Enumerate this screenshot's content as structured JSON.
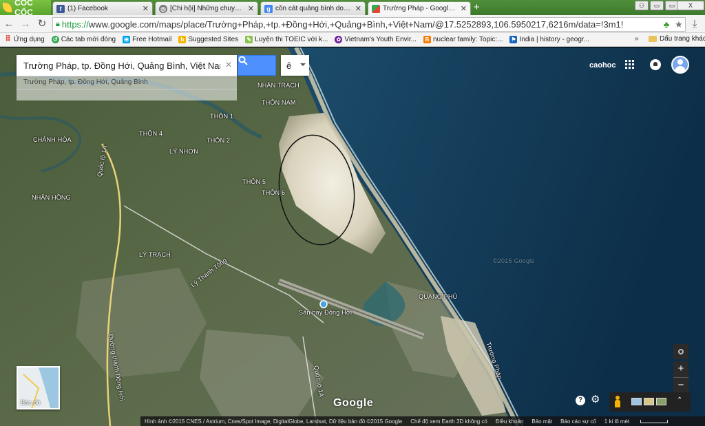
{
  "browser": {
    "brand": "CỐC CỐC",
    "tabs": [
      {
        "title": "(1) Facebook",
        "icon": "facebook-icon"
      },
      {
        "title": "[Chi hội] Những chuyến đi nă",
        "icon": "forum-icon"
      },
      {
        "title": "cồn cát quảng bình dong_hoi",
        "icon": "google-icon"
      },
      {
        "title": "Trường Pháp - Google Maps",
        "icon": "maps-icon",
        "active": true
      }
    ],
    "new_tab": "+",
    "window_controls": [
      "▭",
      "▭",
      "X"
    ],
    "url_scheme": "https://",
    "url_rest": "www.google.com/maps/place/Trường+Pháp,+tp.+Đồng+Hới,+Quảng+Bình,+Việt+Nam/@17.5252893,106.5950217,6216m/data=!3m1!"
  },
  "bookmarks": [
    {
      "label": "Ứng dụng",
      "icon": "apps-grid-icon",
      "color": "#d93025"
    },
    {
      "label": "Các tab mới đóng",
      "icon": "history-icon",
      "color": "#34a853"
    },
    {
      "label": "Free Hotmail",
      "icon": "windows-icon",
      "color": "#00a4ef"
    },
    {
      "label": "Suggested Sites",
      "icon": "bing-icon",
      "color": "#f7b500"
    },
    {
      "label": "Luyện thi TOEIC với k...",
      "icon": "bookmark-icon",
      "color": "#8bc34a"
    },
    {
      "label": "Vietnam's Youth Envir...",
      "icon": "bookmark-icon",
      "color": "#6a1b9a"
    },
    {
      "label": "nuclear family: Topic:...",
      "icon": "blogger-icon",
      "color": "#f57c00"
    },
    {
      "label": "India | history - geogr...",
      "icon": "bookmark-icon",
      "color": "#1565c0"
    }
  ],
  "bookmarks_more": "»",
  "bookmarks_other": "Dấu trang khác",
  "maps": {
    "search_value": "Trường Pháp, tp. Đồng Hới, Quảng Bình, Việt Nam",
    "suggestion": "Trường Pháp, tp. Đồng Hới, Quảng Bình",
    "ime_label": "ê",
    "user_name": "caohoc",
    "minimap_label": "Bản đồ",
    "google_logo": "Google",
    "zoom_in": "+",
    "zoom_out": "−",
    "help": "?",
    "expand": "⌃",
    "attribution": [
      "Hình ảnh ©2015 CNES / Astrium, Cnes/Spot Image, DigitalGlobe, Landsat, Dữ liệu bản đồ ©2015 Google",
      "Chế độ xem Earth 3D không có",
      "Điều khoản",
      "Bảo mật",
      "Báo cáo sự cố",
      "1 ki lô mét"
    ],
    "place_labels": [
      "NHÂN TRẠCH",
      "THÔN NAM",
      "THÔN 1",
      "THÔN 4",
      "THÔN 2",
      "CHÁNH HÒA",
      "LÝ NHƠN",
      "THÔN 5",
      "THÔN 6",
      "NHÂN HỒNG",
      "LÝ TRẠCH",
      "Lý Thánh Tông",
      "Sân bay Đồng Hới",
      "QUANG PHÚ",
      "Trường Pháp",
      "Đường thành Đồng Hới",
      "Quốc lộ 1A",
      "Quốc lộ 1A",
      "©2015 Google"
    ]
  }
}
